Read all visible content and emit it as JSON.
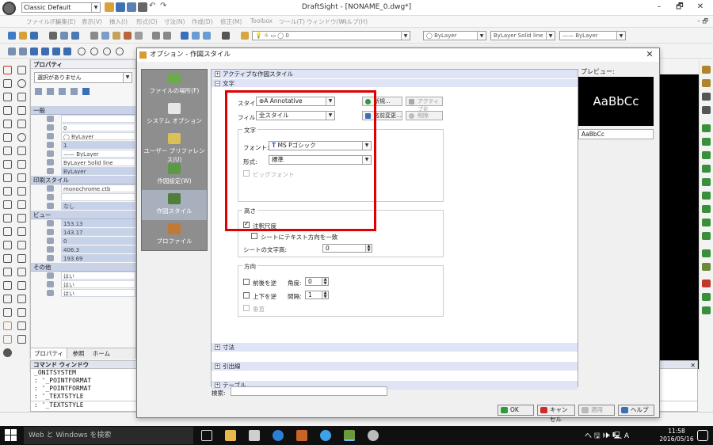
{
  "window": {
    "title": "DraftSight - [NONAME_0.dwg*]",
    "workspace": "Classic Default"
  },
  "menu": [
    "ファイル(F)",
    "編集(E)",
    "表示(V)",
    "挿入(I)",
    "形式(O)",
    "寸法(N)",
    "作成(D)",
    "修正(M)",
    "Toolbox",
    "ツール(T)",
    "ウィンドウ(W)",
    "ヘルプ(H)"
  ],
  "toolbar": {
    "layer": "0",
    "color": "ByLayer",
    "linetype": "ByLayer      Solid line",
    "lineweight": "—— ByLayer"
  },
  "props": {
    "title": "プロパティ",
    "selection": "選択がありません",
    "general": "一般",
    "general_vals": [
      "",
      "0",
      "◯ ByLayer",
      "1",
      "—— ByLayer",
      "ByLayer    Solid line",
      "ByLayer"
    ],
    "print_style": "印刷スタイル",
    "print_vals": [
      "monochrome.ctb",
      "",
      "なし"
    ],
    "view": "ビュー",
    "view_vals": [
      "153.13",
      "143.17",
      "0",
      "406.3",
      "193.69"
    ],
    "other": "その他",
    "other_vals": [
      "はい",
      "はい",
      "はい"
    ],
    "tabs": [
      "プロパティ",
      "参照",
      "ホーム"
    ]
  },
  "command": {
    "title": "コマンド ウィンドウ",
    "lines": [
      "_ONITSYSTEM",
      ": '_POINTFORMAT",
      ": '_POINTFORMAT",
      ": '_TEXTSTYLE",
      ": '_TEXTSTYLE"
    ]
  },
  "dialog": {
    "title": "オプション - 作図スタイル",
    "nav": [
      "ファイルの場所(F)",
      "システム オプション",
      "ユーザー プリファレンス(U)",
      "作図設定(W)",
      "作図スタイル",
      "プロファイル"
    ],
    "groups": {
      "active": "アクティブな作図スタイル",
      "text": "文字",
      "dim": "寸法",
      "leader": "引出線",
      "table": "テーブル"
    },
    "style_label": "スタイル:",
    "style_value": "⊕A Annotative",
    "filter_label": "フィルタ:",
    "filter_value": "全スタイル",
    "btn_new": "新規...",
    "btn_active": "アクティブ化",
    "btn_rename": "名前変更...",
    "btn_delete": "削除",
    "text_group": "文字",
    "font_label": "フォント:",
    "font_value": "MS Pゴシック",
    "form_label": "形式:",
    "form_value": "標準",
    "bigfont": "ビッグフォント",
    "height_group": "高さ",
    "annotative": "注釈尺度",
    "sheet_orient": "シートにテキスト方向を一致",
    "sheet_height_label": "シートの文字高:",
    "sheet_height": "0",
    "dir_group": "方向",
    "backwards": "前後を逆",
    "angle_label": "角度:",
    "angle": "0",
    "upside": "上下を逆",
    "spacing_label": "間隔:",
    "spacing": "1",
    "vertical": "垂直",
    "preview_label": "プレビュー:",
    "preview_text": "AaBbCc",
    "preview_name": "AaBbCc",
    "search_label": "検索:",
    "ok": "OK",
    "cancel": "キャンセル",
    "apply": "適用",
    "help": "ヘルプ"
  },
  "taskbar": {
    "search": "Web と Windows を検索",
    "time": "11:58",
    "date": "2016/05/16",
    "tray": "へ 🖫 🕪 🖳 A"
  },
  "colors": {
    "accent": "#c9d2e6",
    "highlight": "#e00000",
    "canvas": "#000000"
  }
}
